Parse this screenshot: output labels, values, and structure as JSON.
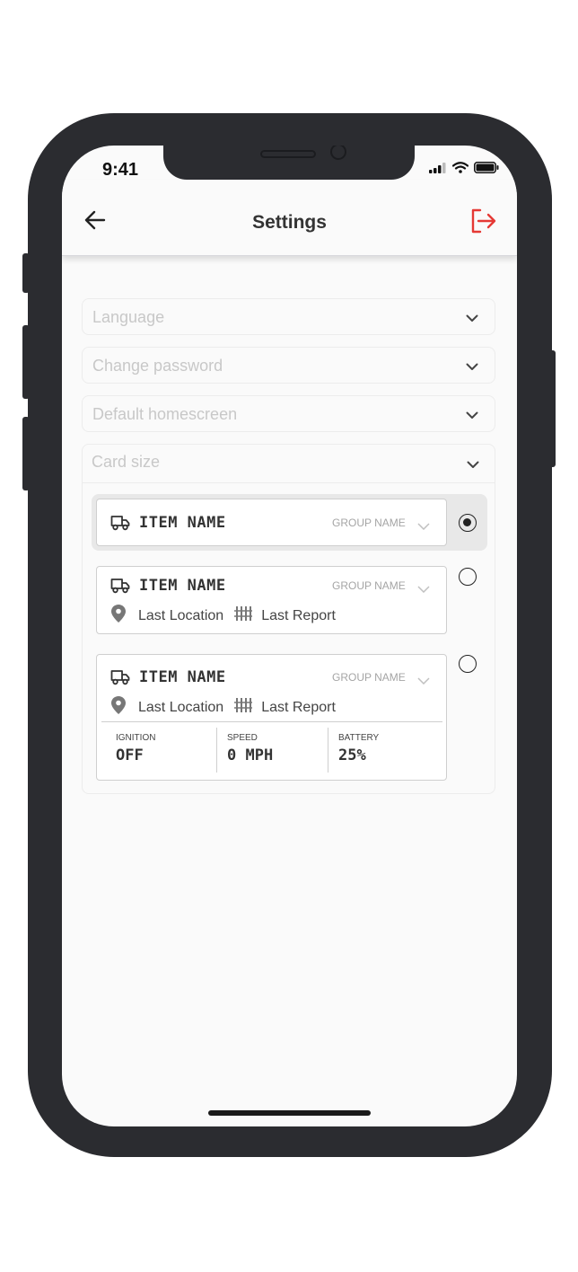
{
  "status": {
    "time": "9:41"
  },
  "header": {
    "title": "Settings"
  },
  "settings": {
    "language": {
      "label": "Language"
    },
    "change_password": {
      "label": "Change password"
    },
    "default_homescreen": {
      "label": "Default homescreen"
    },
    "card_size": {
      "label": "Card size"
    }
  },
  "card_small": {
    "name": "ITEM NAME",
    "group": "GROUP NAME",
    "selected": true
  },
  "card_medium": {
    "name": "ITEM NAME",
    "group": "GROUP NAME",
    "location": "Last Location",
    "report": "Last Report",
    "selected": false
  },
  "card_large": {
    "name": "ITEM NAME",
    "group": "GROUP NAME",
    "location": "Last Location",
    "report": "Last Report",
    "selected": false,
    "metrics": [
      {
        "label": "IGNITION",
        "value": "OFF"
      },
      {
        "label": "SPEED",
        "value": "0 MPH"
      },
      {
        "label": "BATTERY",
        "value": "25%"
      }
    ]
  },
  "colors": {
    "accent": "#e53935",
    "frame": "#2b2c30",
    "screen_bg": "#fafafa"
  },
  "icons": [
    "back-arrow-icon",
    "logout-icon",
    "chevron-down-icon",
    "truck-icon",
    "location-pin-icon",
    "report-icon",
    "signal-icon",
    "wifi-icon",
    "battery-icon"
  ]
}
